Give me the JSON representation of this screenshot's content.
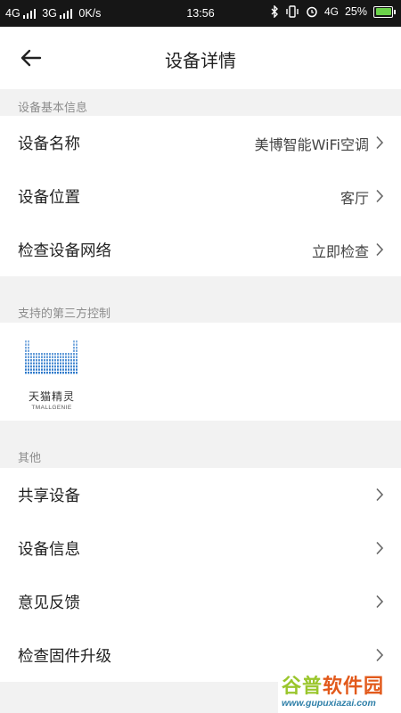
{
  "status_bar": {
    "sim1": "4G",
    "sim2": "3G",
    "speed": "0K/s",
    "time": "13:56",
    "network": "4G",
    "battery": "25%",
    "battery_color": "#6bd24a"
  },
  "header": {
    "title": "设备详情"
  },
  "basic_info": {
    "section_label": "设备基本信息",
    "rows": [
      {
        "label": "设备名称",
        "value": "美博智能WiFi空调"
      },
      {
        "label": "设备位置",
        "value": "客厅"
      },
      {
        "label": "检查设备网络",
        "value": "立即检查"
      }
    ]
  },
  "third_party": {
    "section_label": "支持的第三方控制",
    "items": [
      {
        "name_cn": "天猫精灵",
        "name_en": "TMALLGENIE",
        "color": "#1d6fc7"
      }
    ]
  },
  "other": {
    "section_label": "其他",
    "rows": [
      {
        "label": "共享设备"
      },
      {
        "label": "设备信息"
      },
      {
        "label": "意见反馈"
      },
      {
        "label": "检查固件升级"
      }
    ]
  },
  "watermark": {
    "text_a": "谷普",
    "text_b": "软件园",
    "url": "www.gupuxiazai.com"
  }
}
